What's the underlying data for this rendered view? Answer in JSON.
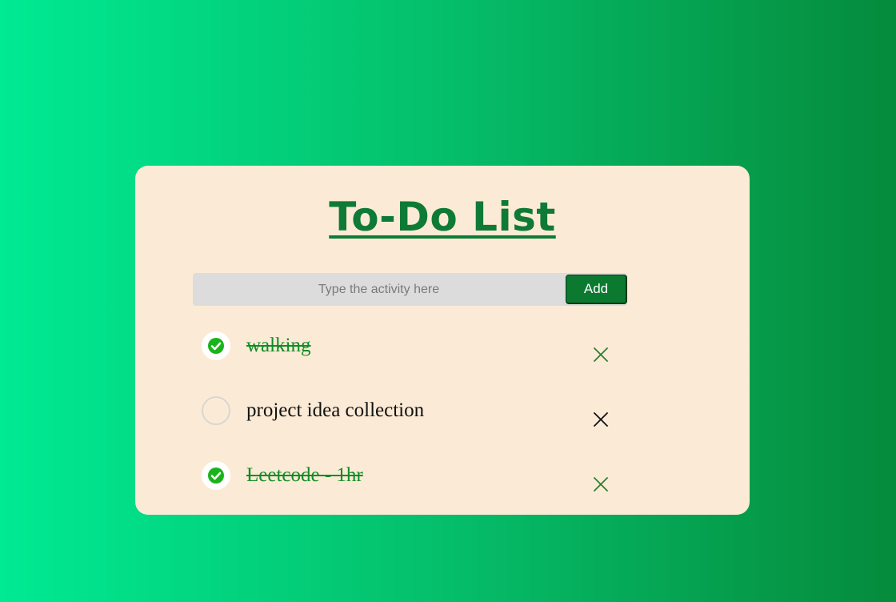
{
  "app": {
    "title": "To-Do List"
  },
  "input": {
    "placeholder": "Type the activity here",
    "value": ""
  },
  "add_button": {
    "label": "Add"
  },
  "items": [
    {
      "text": "walking",
      "completed": true
    },
    {
      "text": "project idea collection",
      "completed": false
    },
    {
      "text": "Leetcode - 1hr",
      "completed": true
    }
  ],
  "icons": {
    "checked": "check-circle-icon",
    "unchecked": "empty-circle-icon",
    "delete": "close-icon"
  },
  "colors": {
    "title": "#0e7a36",
    "card": "#fbebd6",
    "add_button": "#0b7a30",
    "completed_text": "#118c27",
    "check_fill": "#1bb31b"
  }
}
